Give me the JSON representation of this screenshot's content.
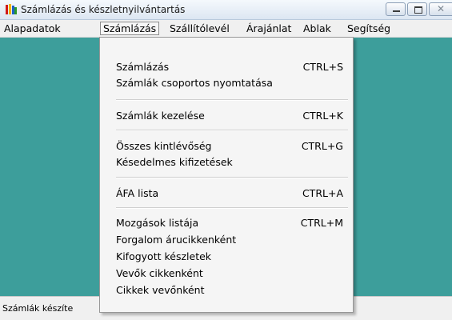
{
  "window": {
    "title": "Számlázás és készletnyilvántartás",
    "accent_color": "#3d9e9b",
    "controls": [
      "minimize-icon",
      "maximize-icon",
      "close-icon"
    ]
  },
  "menubar": {
    "items": [
      {
        "label": "Alapadatok"
      },
      {
        "label": "Számlázás",
        "open": true
      },
      {
        "label": "Szállítólevél"
      },
      {
        "label": "Árajánlat"
      },
      {
        "label": "Ablak"
      },
      {
        "label": "Segítség"
      }
    ]
  },
  "dropdown": {
    "items": [
      {
        "label": "Számlázás",
        "shortcut": "CTRL+S"
      },
      {
        "label": "Számlák csoportos nyomtatása",
        "shortcut": ""
      },
      {
        "label": "Számlák kezelése",
        "shortcut": "CTRL+K"
      },
      {
        "label": "Összes kintlévőség",
        "shortcut": "CTRL+G"
      },
      {
        "label": "Késedelmes kifizetések",
        "shortcut": ""
      },
      {
        "label": "ÁFA lista",
        "shortcut": "CTRL+A"
      },
      {
        "label": "Mozgások listája",
        "shortcut": "CTRL+M"
      },
      {
        "label": "Forgalom árucikkenként",
        "shortcut": ""
      },
      {
        "label": "Kifogyott készletek",
        "shortcut": ""
      },
      {
        "label": "Vevők cikkenként",
        "shortcut": ""
      },
      {
        "label": "Cikkek vevőnként",
        "shortcut": ""
      }
    ]
  },
  "statusbar": {
    "text": "Számlák készíte"
  }
}
